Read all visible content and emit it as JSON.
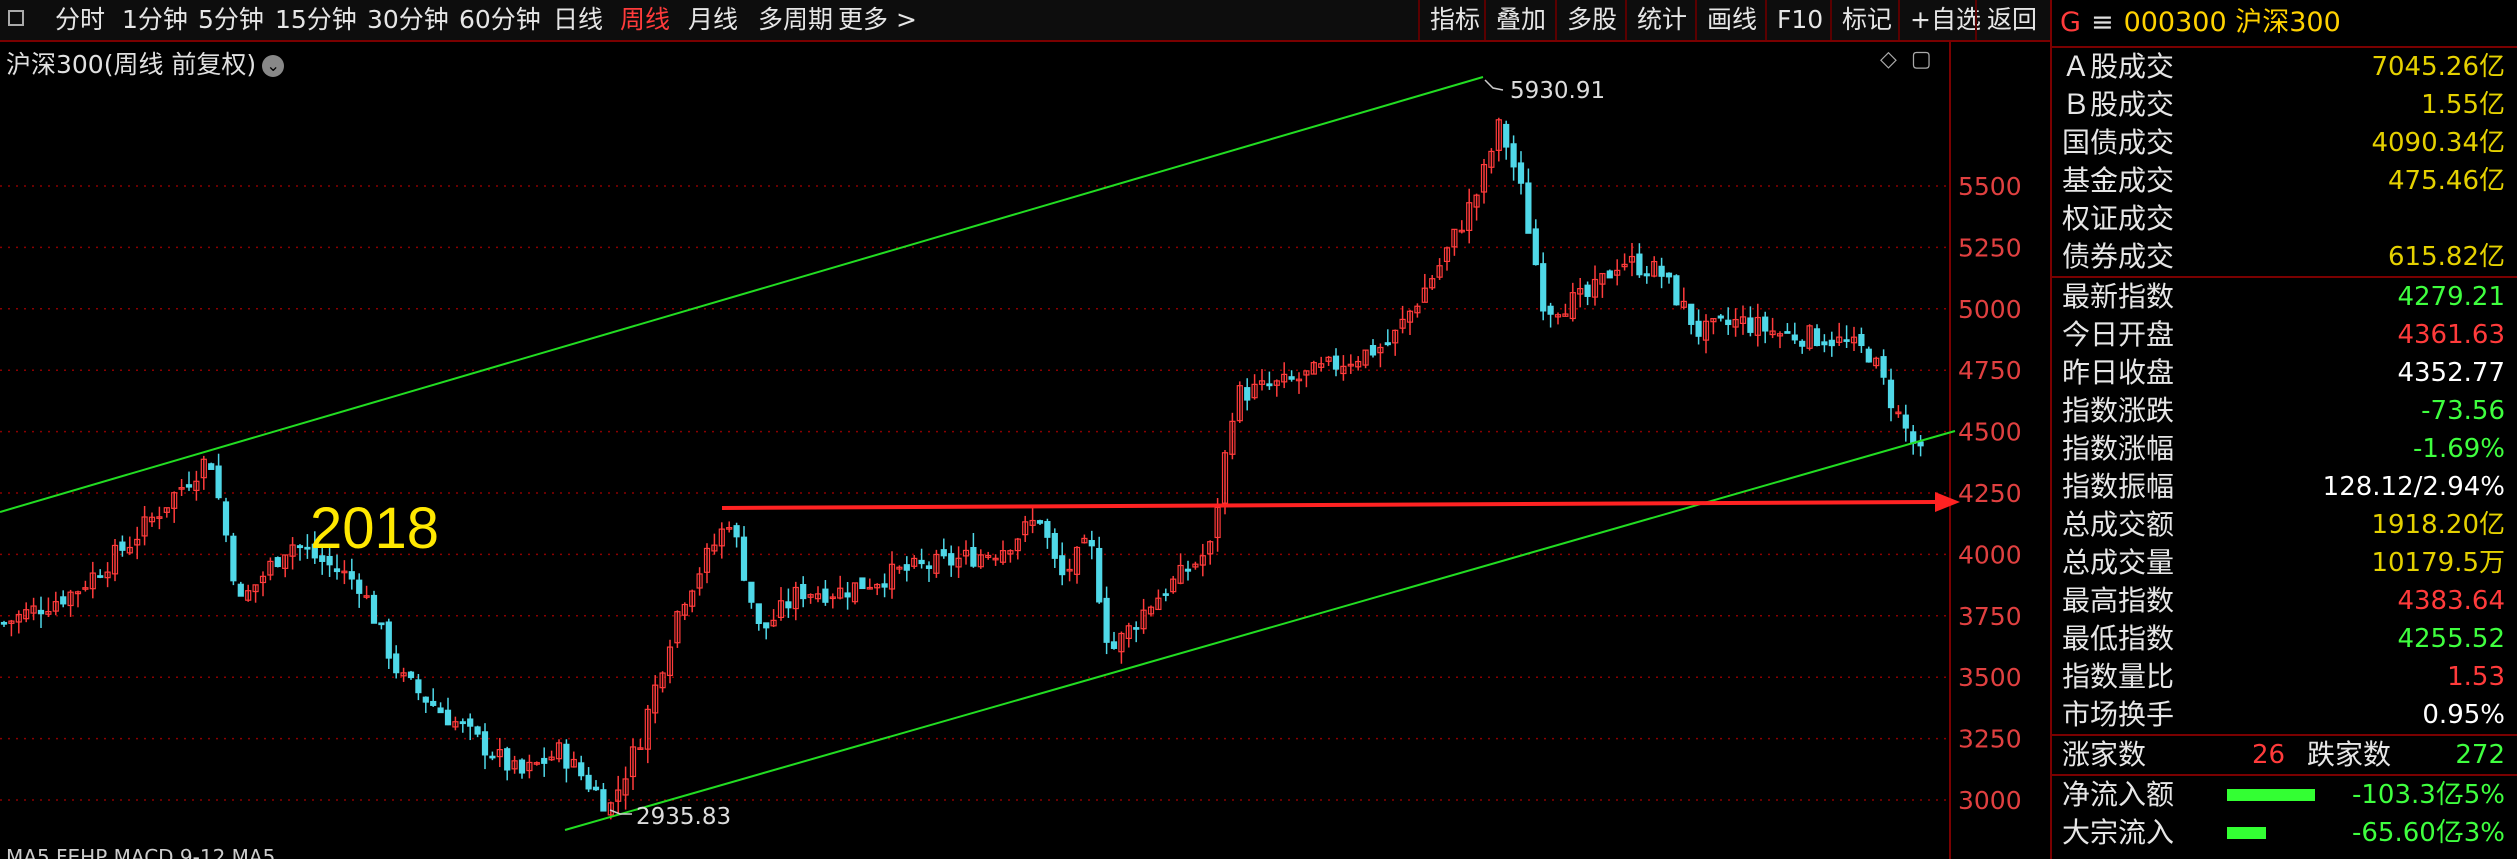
{
  "toolbar": {
    "left_items": [
      {
        "label": "分时",
        "active": false
      },
      {
        "label": "1分钟",
        "active": false
      },
      {
        "label": "5分钟",
        "active": false
      },
      {
        "label": "15分钟",
        "active": false
      },
      {
        "label": "30分钟",
        "active": false
      },
      {
        "label": "60分钟",
        "active": false
      },
      {
        "label": "日线",
        "active": false
      },
      {
        "label": "周线",
        "active": true
      },
      {
        "label": "月线",
        "active": false
      },
      {
        "label": "多周期",
        "active": false
      },
      {
        "label": "更多 >",
        "active": false
      }
    ],
    "right_items": [
      "指标",
      "叠加",
      "多股",
      "统计",
      "画线",
      "F10",
      "标记",
      "+自选",
      "返回"
    ]
  },
  "chart": {
    "title": "沪深300(周线 前复权)",
    "annotation_year": "2018",
    "high_label": "5930.91",
    "low_label": "2935.83",
    "bottom_indicator_text": "MA5 FEHP MACD 9-12 MA5",
    "colors": {
      "up": "#ff3b3b",
      "down": "#4fd8e8",
      "channel": "#22dd22",
      "support": "#ff2222",
      "grid": "#8b0000",
      "axis_text": "#e04040"
    }
  },
  "chart_data": {
    "type": "candlestick",
    "y_axis_ticks": [
      3000,
      3250,
      3500,
      3750,
      4000,
      4250,
      4500,
      4750,
      5000,
      5250,
      5500
    ],
    "ylim": [
      2900,
      6000
    ],
    "annotations": [
      {
        "text": "5930.91",
        "value": 5930.91
      },
      {
        "text": "2935.83",
        "value": 2935.83
      },
      {
        "text": "2018"
      }
    ],
    "support_level": 4200
  },
  "panel": {
    "header": {
      "prefix": "G",
      "eq": "≡",
      "code": "000300",
      "name": "沪深300"
    },
    "rows": [
      {
        "label": "Ａ股成交",
        "value": "7045.26亿",
        "color": "yellow"
      },
      {
        "label": "Ｂ股成交",
        "value": "1.55亿",
        "color": "yellow"
      },
      {
        "label": "国债成交",
        "value": "4090.34亿",
        "color": "yellow"
      },
      {
        "label": "基金成交",
        "value": "475.46亿",
        "color": "yellow"
      },
      {
        "label": "权证成交",
        "value": "",
        "color": "yellow"
      },
      {
        "label": "债券成交",
        "value": "615.82亿",
        "color": "yellow"
      }
    ],
    "rows2": [
      {
        "label": "最新指数",
        "value": "4279.21",
        "color": "green"
      },
      {
        "label": "今日开盘",
        "value": "4361.63",
        "color": "red"
      },
      {
        "label": "昨日收盘",
        "value": "4352.77",
        "color": "white"
      },
      {
        "label": "指数涨跌",
        "value": "-73.56",
        "color": "green"
      },
      {
        "label": "指数涨幅",
        "value": "-1.69%",
        "color": "green"
      },
      {
        "label": "指数振幅",
        "value": "128.12/2.94%",
        "color": "white"
      },
      {
        "label": "总成交额",
        "value": "1918.20亿",
        "color": "yellow"
      },
      {
        "label": "总成交量",
        "value": "10179.5万",
        "color": "yellow"
      },
      {
        "label": "最高指数",
        "value": "4383.64",
        "color": "red"
      },
      {
        "label": "最低指数",
        "value": "4255.52",
        "color": "green"
      },
      {
        "label": "指数量比",
        "value": "1.53",
        "color": "red"
      },
      {
        "label": "市场换手",
        "value": "0.95%",
        "color": "white"
      }
    ],
    "adv_dec": {
      "up_label": "涨家数",
      "up_value": "26",
      "down_label": "跌家数",
      "down_value": "272"
    },
    "flows": [
      {
        "label": "净流入额",
        "value": "-103.3亿",
        "pct": "-5%",
        "fill": 0.8
      },
      {
        "label": "大宗流入",
        "value": "-65.60亿",
        "pct": "-3%",
        "fill": 0.35
      }
    ]
  }
}
